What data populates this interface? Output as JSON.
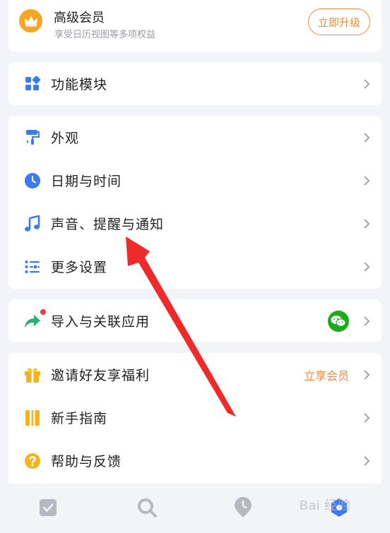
{
  "premium": {
    "title": "高级会员",
    "subtitle": "享受日历视图等多项权益",
    "upgrade_label": "立即升级",
    "accent": "#f08a3c",
    "crown_color": "#f6a623"
  },
  "modules": {
    "items": [
      {
        "label": "功能模块",
        "icon": "grid-icon"
      }
    ]
  },
  "settings": {
    "items": [
      {
        "label": "外观",
        "icon": "paint-roller-icon"
      },
      {
        "label": "日期与时间",
        "icon": "clock-icon"
      },
      {
        "label": "声音、提醒与通知",
        "icon": "music-note-icon"
      },
      {
        "label": "更多设置",
        "icon": "list-settings-icon"
      }
    ]
  },
  "integrations": {
    "items": [
      {
        "label": "导入与关联应用",
        "icon": "share-arrow-icon",
        "badge": "wechat-icon",
        "has_red_dot": true
      }
    ]
  },
  "misc": {
    "items": [
      {
        "label": "邀请好友享福利",
        "icon": "gift-icon",
        "extra": "立享会员"
      },
      {
        "label": "新手指南",
        "icon": "book-icon"
      },
      {
        "label": "帮助与反馈",
        "icon": "question-icon"
      }
    ]
  },
  "tabbar": {
    "items": [
      {
        "icon": "checkbox-icon"
      },
      {
        "icon": "search-icon"
      },
      {
        "icon": "clock-pin-icon"
      },
      {
        "icon": "settings-icon"
      }
    ]
  },
  "watermark": {
    "text": "Bai 经验"
  },
  "colors": {
    "icon_blue": "#3c7af0",
    "background": "#f3f4f8",
    "arrow_red": "#ee2a2a",
    "green": "#2ab07a",
    "yellow": "#f5b21b"
  }
}
